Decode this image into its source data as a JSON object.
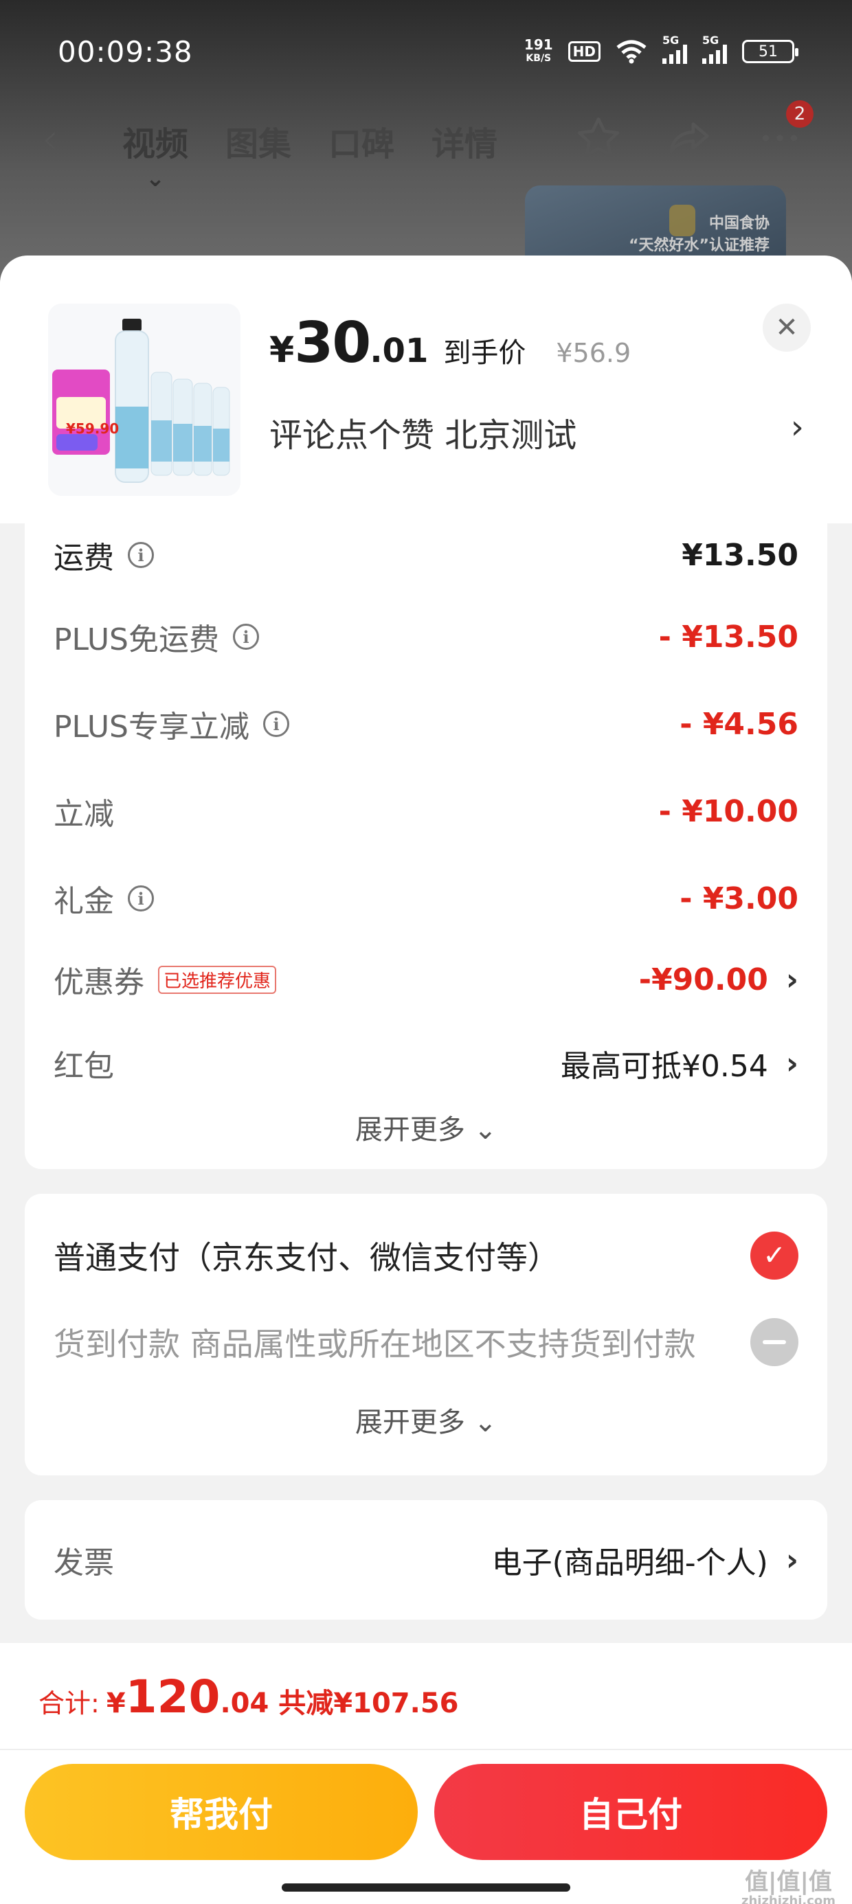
{
  "status_bar": {
    "time": "00:09:38",
    "net_speed_value": "191",
    "net_speed_unit": "KB/S",
    "hd_label": "HD",
    "signal_1": "5G",
    "signal_2": "5G",
    "battery": "51"
  },
  "background_page": {
    "tabs": [
      "视频",
      "图集",
      "口碑",
      "详情"
    ],
    "active_tab": "视频",
    "cart_badge": "2",
    "banner_line1": "中国食协",
    "banner_line2": "“天然好水”认证推荐"
  },
  "product": {
    "thumb_price": "¥59.90",
    "price_yen": "¥",
    "price_int": "30",
    "price_dec": ".01",
    "price_tag": "到手价",
    "original_price": "¥56.9",
    "spec_text": "评论点个赞  北京测试"
  },
  "price_detail": {
    "freight_label": "运费",
    "freight_value": "¥13.50",
    "plus_free_label": "PLUS免运费",
    "plus_free_value": "- ¥13.50",
    "plus_discount_label": "PLUS专享立减",
    "plus_discount_value": "- ¥4.56",
    "instant_label": "立减",
    "instant_value": "- ¥10.00",
    "gift_label": "礼金",
    "gift_value": "- ¥3.00",
    "coupon_label": "优惠券",
    "coupon_tag": "已选推荐优惠",
    "coupon_value": "-¥90.00",
    "redpack_label": "红包",
    "redpack_value": "最高可抵¥0.54",
    "expand_more": "展开更多"
  },
  "payment": {
    "normal_label": "普通支付（京东支付、微信支付等）",
    "cod_label": "货到付款 商品属性或所在地区不支持货到付款",
    "expand_more": "展开更多"
  },
  "invoice": {
    "label": "发票",
    "value": "电子(商品明细-个人)"
  },
  "footer": {
    "total_label": "合计:",
    "total_yen": "¥",
    "total_int": "120",
    "total_dec": ".04",
    "total_saved": "共减¥107.56",
    "help_pay": "帮我付",
    "self_pay": "自己付",
    "watermark": "值|值|值",
    "watermark_sub": "zhizhizhi.com"
  },
  "colors": {
    "accent_red": "#e1251b",
    "button_yellow": "#fdc324",
    "button_red": "#f33a46"
  }
}
